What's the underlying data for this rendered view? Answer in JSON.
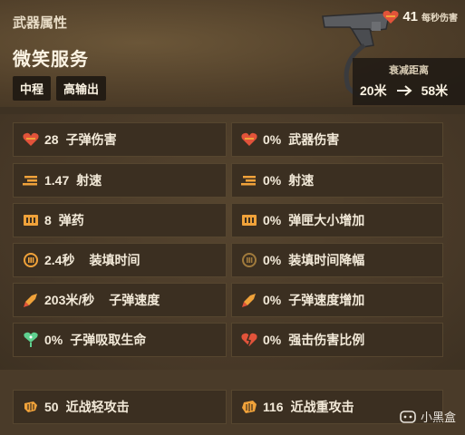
{
  "header": {
    "section_label": "武器属性",
    "weapon_name": "微笑服务",
    "tags": [
      "中程",
      "高输出"
    ],
    "dps_value": "41",
    "dps_label": "每秒伤害",
    "falloff_title": "衰减距离",
    "falloff_from": "20米",
    "falloff_to": "58米"
  },
  "stats": {
    "left": [
      {
        "icon": "bullet-damage-icon",
        "value": "28",
        "label": "子弹伤害"
      },
      {
        "icon": "fire-rate-icon",
        "value": "1.47",
        "label": "射速"
      },
      {
        "icon": "ammo-icon",
        "value": "8",
        "label": "弹药"
      },
      {
        "icon": "reload-icon",
        "value": "2.4秒",
        "label": "装填时间"
      },
      {
        "icon": "bullet-velocity-icon",
        "value": "203米/秒",
        "label": "子弹速度"
      },
      {
        "icon": "lifesteal-icon",
        "value": "0%",
        "label": "子弹吸取生命"
      }
    ],
    "right": [
      {
        "icon": "weapon-damage-icon",
        "value": "0%",
        "label": "武器伤害"
      },
      {
        "icon": "fire-rate-icon",
        "value": "0%",
        "label": "射速"
      },
      {
        "icon": "clip-size-icon",
        "value": "0%",
        "label": "弹匣大小增加"
      },
      {
        "icon": "reload-reduction-icon",
        "value": "0%",
        "label": "装填时间降幅"
      },
      {
        "icon": "bullet-velocity-icon",
        "value": "0%",
        "label": "子弹速度增加"
      },
      {
        "icon": "crit-damage-icon",
        "value": "0%",
        "label": "强击伤害比例"
      }
    ]
  },
  "melee": {
    "light": {
      "icon": "light-melee-icon",
      "value": "50",
      "label": "近战轻攻击"
    },
    "heavy": {
      "icon": "heavy-melee-icon",
      "value": "116",
      "label": "近战重攻击"
    }
  },
  "watermark": {
    "text": "小黑盒"
  },
  "colors": {
    "accent_orange": "#f0a23a",
    "damage_red": "#e2533a",
    "lifesteal_green": "#5fd08f"
  }
}
